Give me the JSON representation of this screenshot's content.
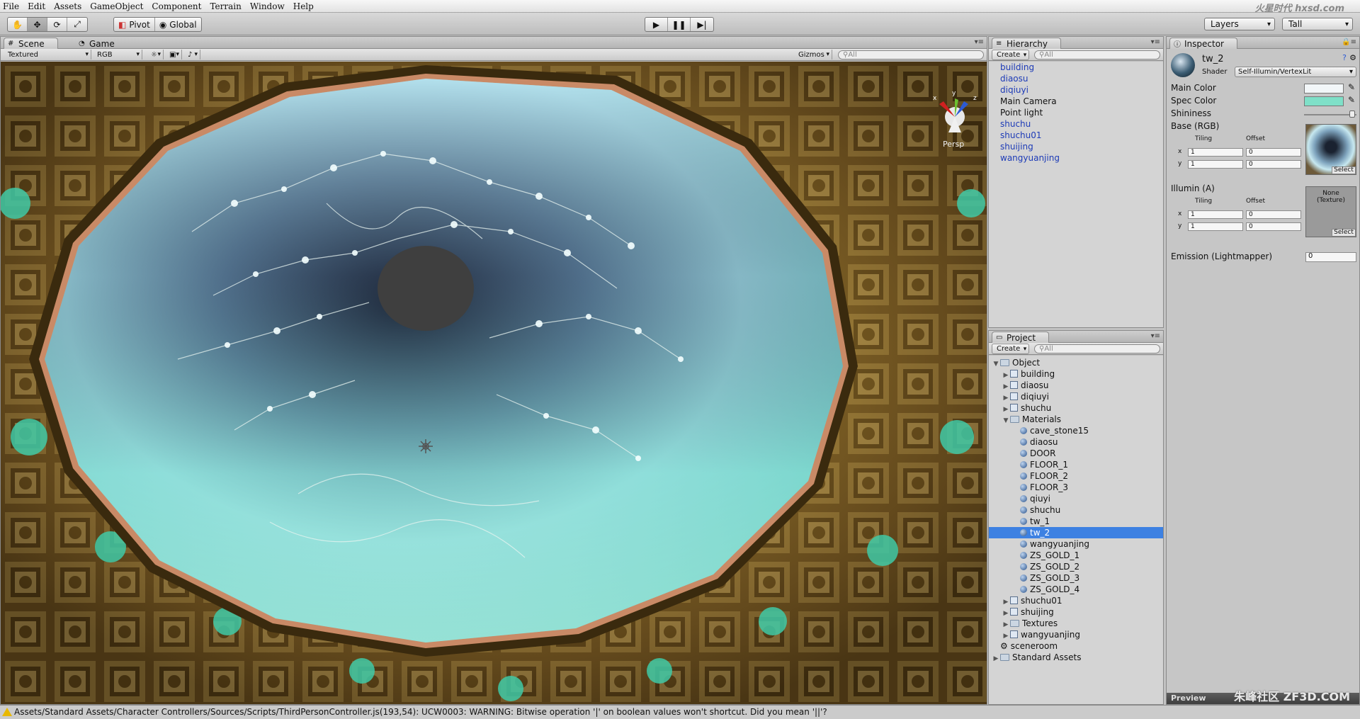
{
  "menu": [
    "File",
    "Edit",
    "Assets",
    "GameObject",
    "Component",
    "Terrain",
    "Window",
    "Help"
  ],
  "toolbar": {
    "pivot": "Pivot",
    "global": "Global",
    "layers": "Layers",
    "layout": "Tall"
  },
  "scene": {
    "tab_scene": "Scene",
    "tab_game": "Game",
    "render_mode": "Textured",
    "color_mode": "RGB",
    "gizmos": "Gizmos",
    "search_placeholder": "All",
    "persp": "Persp",
    "axis_x": "x",
    "axis_y": "y",
    "axis_z": "z"
  },
  "hierarchy": {
    "title": "Hierarchy",
    "create": "Create",
    "search_placeholder": "All",
    "items": [
      {
        "label": "building",
        "prefab": true
      },
      {
        "label": "diaosu",
        "prefab": true
      },
      {
        "label": "diqiuyi",
        "prefab": true
      },
      {
        "label": "Main Camera",
        "prefab": false
      },
      {
        "label": "Point light",
        "prefab": false
      },
      {
        "label": "shuchu",
        "prefab": true
      },
      {
        "label": "shuchu01",
        "prefab": true
      },
      {
        "label": "shuijing",
        "prefab": true
      },
      {
        "label": "wangyuanjing",
        "prefab": true
      }
    ]
  },
  "project": {
    "title": "Project",
    "create": "Create",
    "search_placeholder": "All",
    "items": [
      {
        "label": "Object",
        "depth": 0,
        "icon": "folder",
        "arrow": "open"
      },
      {
        "label": "building",
        "depth": 1,
        "icon": "prefab",
        "arrow": "closed"
      },
      {
        "label": "diaosu",
        "depth": 1,
        "icon": "prefab",
        "arrow": "closed"
      },
      {
        "label": "diqiuyi",
        "depth": 1,
        "icon": "prefab",
        "arrow": "closed"
      },
      {
        "label": "shuchu",
        "depth": 1,
        "icon": "prefab",
        "arrow": "closed"
      },
      {
        "label": "Materials",
        "depth": 1,
        "icon": "folder",
        "arrow": "open"
      },
      {
        "label": "cave_stone15",
        "depth": 2,
        "icon": "material",
        "arrow": "none"
      },
      {
        "label": "diaosu",
        "depth": 2,
        "icon": "material",
        "arrow": "none"
      },
      {
        "label": "DOOR",
        "depth": 2,
        "icon": "material",
        "arrow": "none"
      },
      {
        "label": "FLOOR_1",
        "depth": 2,
        "icon": "material",
        "arrow": "none"
      },
      {
        "label": "FLOOR_2",
        "depth": 2,
        "icon": "material",
        "arrow": "none"
      },
      {
        "label": "FLOOR_3",
        "depth": 2,
        "icon": "material",
        "arrow": "none"
      },
      {
        "label": "qiuyi",
        "depth": 2,
        "icon": "material",
        "arrow": "none"
      },
      {
        "label": "shuchu",
        "depth": 2,
        "icon": "material",
        "arrow": "none"
      },
      {
        "label": "tw_1",
        "depth": 2,
        "icon": "material",
        "arrow": "none"
      },
      {
        "label": "tw_2",
        "depth": 2,
        "icon": "material",
        "arrow": "none",
        "selected": true
      },
      {
        "label": "wangyuanjing",
        "depth": 2,
        "icon": "material",
        "arrow": "none"
      },
      {
        "label": "ZS_GOLD_1",
        "depth": 2,
        "icon": "material",
        "arrow": "none"
      },
      {
        "label": "ZS_GOLD_2",
        "depth": 2,
        "icon": "material",
        "arrow": "none"
      },
      {
        "label": "ZS_GOLD_3",
        "depth": 2,
        "icon": "material",
        "arrow": "none"
      },
      {
        "label": "ZS_GOLD_4",
        "depth": 2,
        "icon": "material",
        "arrow": "none"
      },
      {
        "label": "shuchu01",
        "depth": 1,
        "icon": "prefab",
        "arrow": "closed"
      },
      {
        "label": "shuijing",
        "depth": 1,
        "icon": "prefab",
        "arrow": "closed"
      },
      {
        "label": "Textures",
        "depth": 1,
        "icon": "folder",
        "arrow": "closed"
      },
      {
        "label": "wangyuanjing",
        "depth": 1,
        "icon": "prefab",
        "arrow": "closed"
      },
      {
        "label": "sceneroom",
        "depth": 0,
        "icon": "scene",
        "arrow": "none"
      },
      {
        "label": "Standard Assets",
        "depth": 0,
        "icon": "folder",
        "arrow": "closed"
      }
    ]
  },
  "inspector": {
    "title": "Inspector",
    "name": "tw_2",
    "shader_label": "Shader",
    "shader": "Self-Illumin/VertexLit",
    "main_color_label": "Main Color",
    "spec_color_label": "Spec Color",
    "shininess_label": "Shininess",
    "base_label": "Base (RGB)",
    "tiling": "Tiling",
    "offset": "Offset",
    "x": "x",
    "y": "y",
    "base_tiling_x": "1",
    "base_tiling_y": "1",
    "base_offset_x": "0",
    "base_offset_y": "0",
    "illum_label": "Illumin (A)",
    "illum_tex": "None\n(Texture)",
    "illum_tiling_x": "1",
    "illum_tiling_y": "1",
    "illum_offset_x": "0",
    "illum_offset_y": "0",
    "select": "Select",
    "emission_label": "Emission (Lightmapper)",
    "emission": "0",
    "preview": "Preview",
    "main_color": "#f2f6f8",
    "spec_color": "#7fe0c8",
    "shininess": 0.92
  },
  "watermark_top": "火星时代 hxsd.com",
  "watermark_bottom": "朱峰社区 ZF3D.COM",
  "status": "Assets/Standard Assets/Character Controllers/Sources/Scripts/ThirdPersonController.js(193,54): UCW0003: WARNING: Bitwise operation '|' on boolean values won't shortcut. Did you mean '||'?"
}
